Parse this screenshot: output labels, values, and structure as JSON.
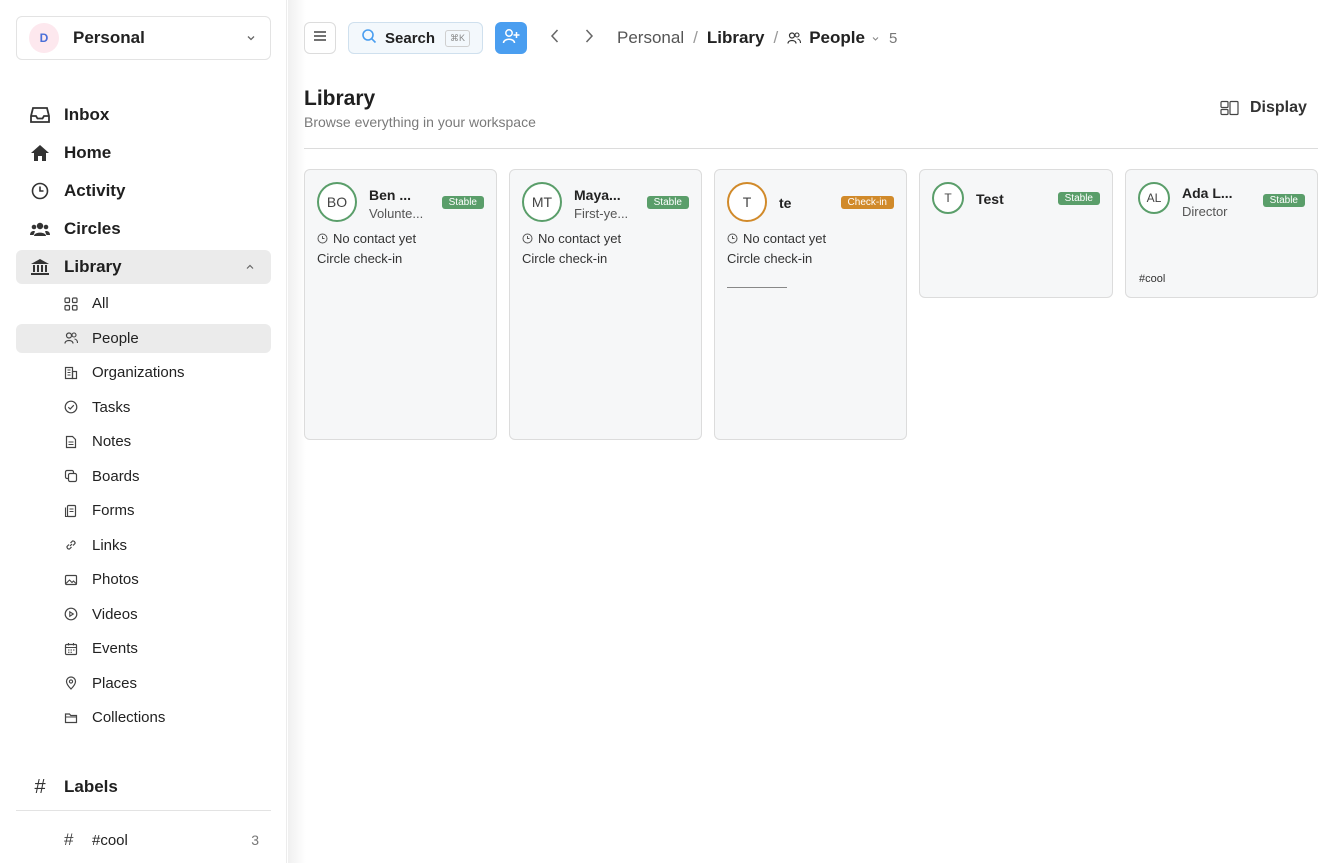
{
  "workspace": {
    "initial": "D",
    "name": "Personal"
  },
  "nav": [
    {
      "label": "Inbox",
      "icon": "inbox-icon"
    },
    {
      "label": "Home",
      "icon": "home-icon"
    },
    {
      "label": "Activity",
      "icon": "clock-icon"
    },
    {
      "label": "Circles",
      "icon": "users-icon"
    },
    {
      "label": "Library",
      "icon": "library-icon",
      "active": true
    }
  ],
  "library_items": [
    {
      "label": "All"
    },
    {
      "label": "People",
      "active": true
    },
    {
      "label": "Organizations"
    },
    {
      "label": "Tasks"
    },
    {
      "label": "Notes"
    },
    {
      "label": "Boards"
    },
    {
      "label": "Forms"
    },
    {
      "label": "Links"
    },
    {
      "label": "Photos"
    },
    {
      "label": "Videos"
    },
    {
      "label": "Events"
    },
    {
      "label": "Places"
    },
    {
      "label": "Collections"
    }
  ],
  "labels": {
    "heading": "Labels",
    "items": [
      {
        "name": "#cool",
        "count": "3"
      }
    ]
  },
  "toolbar": {
    "search_label": "Search",
    "search_shortcut": "⌘K"
  },
  "breadcrumb": {
    "root": "Personal",
    "section": "Library",
    "current": "People",
    "count": "5"
  },
  "header": {
    "title": "Library",
    "subtitle": "Browse everything in your workspace",
    "display_label": "Display"
  },
  "cards": [
    {
      "initials": "BO",
      "name": "Ben ...",
      "role": "Volunte...",
      "badge": "Stable",
      "contact": "No contact yet",
      "cadence": "Circle check-in"
    },
    {
      "initials": "MT",
      "name": "Maya...",
      "role": "First-ye...",
      "badge": "Stable",
      "contact": "No contact yet",
      "cadence": "Circle check-in"
    },
    {
      "initials": "T",
      "name": "te",
      "badge": "Check-in",
      "contact": "No contact yet",
      "cadence": "Circle check-in"
    },
    {
      "initials": "T",
      "name": "Test",
      "badge": "Stable"
    },
    {
      "initials": "AL",
      "name": "Ada L...",
      "role": "Director",
      "badge": "Stable",
      "tag": "#cool"
    }
  ],
  "colors": {
    "accent": "#4a9ef0",
    "stable": "#5a9e6a",
    "checkin": "#d18a2a"
  }
}
